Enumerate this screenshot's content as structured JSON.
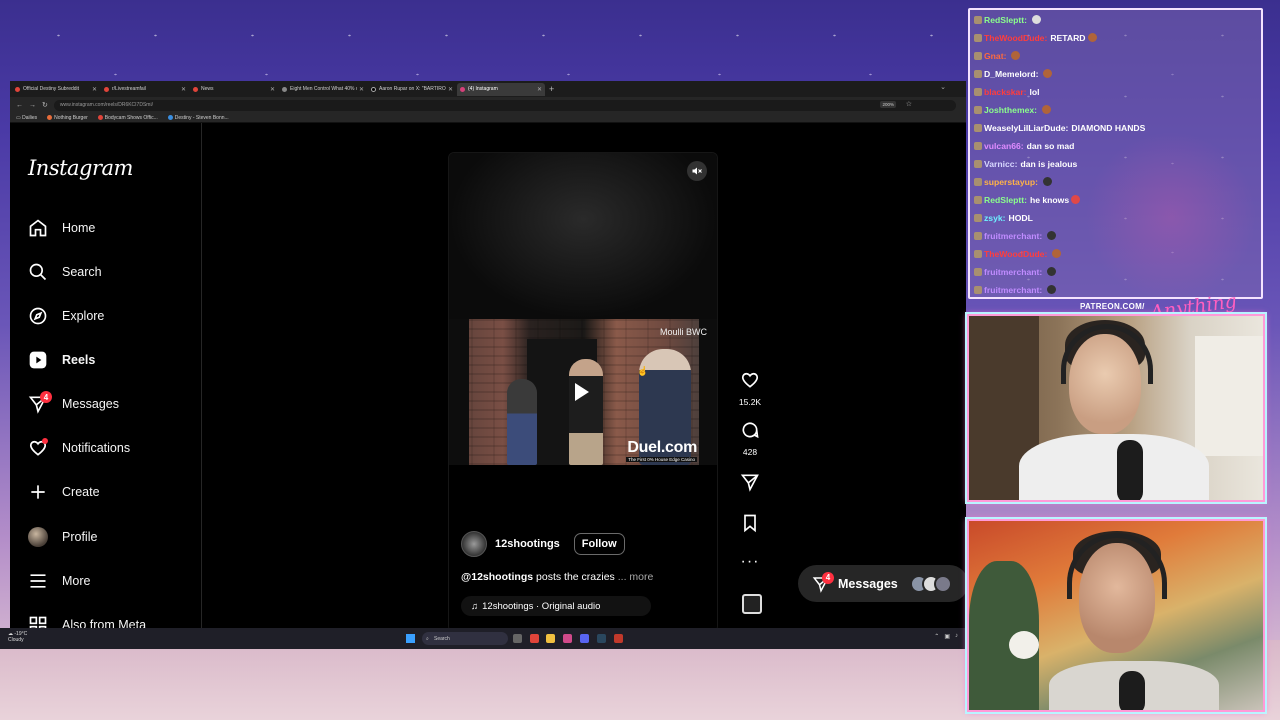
{
  "browser": {
    "tabs": [
      {
        "title": "Official Destiny Subreddit",
        "active": false
      },
      {
        "title": "r/Livestreamfail",
        "active": false
      },
      {
        "title": "News",
        "active": false
      },
      {
        "title": "Eight Men Control What 40% o",
        "active": false
      },
      {
        "title": "Aaron Rupar on X: \"BARTIROM",
        "active": false
      },
      {
        "title": "(4) Instagram",
        "active": true
      }
    ],
    "url": "www.instagram.com/reels/DR6KCI7DSmi/",
    "zoom": "200%",
    "bookmarks": [
      "Dailies",
      "Nothing Burger",
      "Bodycam Shows Offic...",
      "Destiny - Steven Bonn..."
    ]
  },
  "instagram": {
    "logo": "Instagram",
    "nav": [
      {
        "label": "Home",
        "icon": "home-icon"
      },
      {
        "label": "Search",
        "icon": "search-icon"
      },
      {
        "label": "Explore",
        "icon": "compass-icon"
      },
      {
        "label": "Reels",
        "icon": "reels-icon"
      },
      {
        "label": "Messages",
        "icon": "messenger-icon",
        "badge": "4"
      },
      {
        "label": "Notifications",
        "icon": "heart-icon"
      },
      {
        "label": "Create",
        "icon": "plus-icon"
      },
      {
        "label": "Profile",
        "icon": "avatar"
      },
      {
        "label": "More",
        "icon": "menu-icon"
      },
      {
        "label": "Also from Meta",
        "icon": "meta-icon"
      }
    ],
    "reel": {
      "overlay_watermark": "Moulli BWC",
      "brand": "Duel.com",
      "brand_sub": "The First 0% House Edge Casino",
      "author": "12shootings",
      "follow_label": "Follow",
      "caption_handle": "@12shootings",
      "caption_text": "posts the crazies",
      "caption_more": "... more",
      "audio": "12shootings · Original audio"
    },
    "actions": {
      "likes": "15.2K",
      "comments": "428"
    },
    "messages_pill": {
      "label": "Messages",
      "badge": "4"
    }
  },
  "taskbar": {
    "weather_temp": "-19°C",
    "weather_desc": "Cloudy",
    "search_placeholder": "Search"
  },
  "chat": {
    "messages": [
      {
        "user": "RedSleptt:",
        "text": "",
        "color": "#8cff8c",
        "emote": "gray"
      },
      {
        "user": "TheWoodDude:",
        "text": "RETARD",
        "color": "#ff3d3d",
        "emote": "brown"
      },
      {
        "user": "Gnat:",
        "text": "",
        "color": "#ff6a3d",
        "emote": "brown"
      },
      {
        "user": "D_Memelord:",
        "text": "",
        "color": "#ffffff",
        "emote": "brown"
      },
      {
        "user": "blackskar:",
        "text": "lol",
        "color": "#ff3d3d",
        "emote": ""
      },
      {
        "user": "Joshthemex:",
        "text": "",
        "color": "#8cff8c",
        "emote": "brown"
      },
      {
        "user": "WeaselyLilLiarDude:",
        "text": "DIAMOND HANDS",
        "color": "#ffffff",
        "emote": ""
      },
      {
        "user": "vulcan66:",
        "text": "dan so mad",
        "color": "#e08cff",
        "emote": ""
      },
      {
        "user": "Varnicc:",
        "text": "dan is jealous",
        "color": "#d8d8ff",
        "emote": ""
      },
      {
        "user": "superstayup:",
        "text": "",
        "color": "#ffb347",
        "emote": "dark"
      },
      {
        "user": "RedSleptt:",
        "text": "he knows",
        "color": "#8cff8c",
        "emote": "red"
      },
      {
        "user": "zsyk:",
        "text": "HODL",
        "color": "#6ef0ff",
        "emote": ""
      },
      {
        "user": "fruitmerchant:",
        "text": "",
        "color": "#c08cff",
        "emote": "dark"
      },
      {
        "user": "TheWoodDude:",
        "text": "",
        "color": "#ff3d3d",
        "emote": "brown"
      },
      {
        "user": "fruitmerchant:",
        "text": "",
        "color": "#c08cff",
        "emote": "dark"
      },
      {
        "user": "fruitmerchant:",
        "text": "",
        "color": "#c08cff",
        "emote": "dark"
      }
    ]
  },
  "overlay": {
    "patreon": "PATREON.COM/",
    "signature": "Anything"
  },
  "colors": {
    "badge": "#ff3040",
    "cam_border": "#ff9ad8",
    "cam_glow": "#b9f4ff"
  }
}
